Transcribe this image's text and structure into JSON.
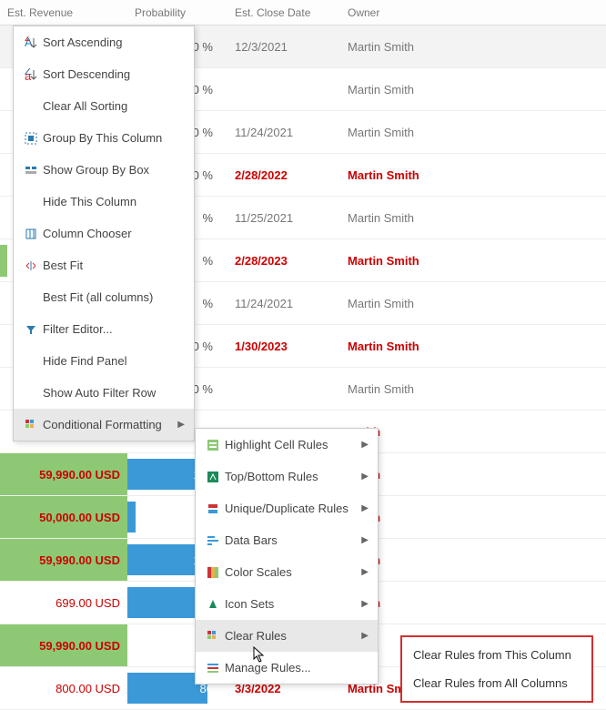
{
  "headers": {
    "revenue": "Est. Revenue",
    "probability": "Probability",
    "closeDate": "Est. Close Date",
    "owner": "Owner"
  },
  "rows": [
    {
      "rev": "",
      "prob": "0 %",
      "probPct": 0,
      "date": "12/3/2021",
      "owner": "Martin Smith",
      "bold": false,
      "sel": true
    },
    {
      "rev": "",
      "prob": "0 %",
      "probPct": 0,
      "date": "",
      "owner": "Martin Smith",
      "bold": false
    },
    {
      "rev": "",
      "prob": "0 %",
      "probPct": 0,
      "date": "11/24/2021",
      "owner": "Martin Smith",
      "bold": false,
      "barLeft": true
    },
    {
      "rev": "",
      "prob": "0 %",
      "probPct": 0,
      "date": "2/28/2022",
      "owner": "Martin Smith",
      "bold": true
    },
    {
      "rev": "",
      "prob": "%",
      "probPct": 5,
      "date": "11/25/2021",
      "owner": "Martin Smith",
      "bold": false
    },
    {
      "rev": "",
      "prob": "%",
      "probPct": 5,
      "date": "2/28/2023",
      "owner": "Martin Smith",
      "bold": true,
      "handle": true
    },
    {
      "rev": "",
      "prob": "%",
      "probPct": 5,
      "date": "11/24/2021",
      "owner": "Martin Smith",
      "bold": false
    },
    {
      "rev": "",
      "prob": "0 %",
      "probPct": 0,
      "date": "1/30/2023",
      "owner": "Martin Smith",
      "bold": true
    },
    {
      "rev": "",
      "prob": "0 %",
      "probPct": 0,
      "date": "",
      "owner": "Martin Smith",
      "bold": false
    },
    {
      "rev": "",
      "prob": "",
      "probPct": 0,
      "date": "",
      "owner": "Smith",
      "bold": true,
      "ownerOnly": true
    },
    {
      "rev": "59,990.00 USD",
      "prob": "100",
      "probPct": 100,
      "date": "",
      "owner": "Smith",
      "bold": true,
      "green": true
    },
    {
      "rev": "50,000.00 USD",
      "prob": "",
      "probPct": 8,
      "date": "",
      "owner": "Smith",
      "bold": true,
      "green": true
    },
    {
      "rev": "59,990.00 USD",
      "prob": "100",
      "probPct": 100,
      "date": "",
      "owner": "Smith",
      "bold": true,
      "green": true
    },
    {
      "rev": "699.00 USD",
      "prob": "80",
      "probPct": 80,
      "date": "",
      "owner": "Smith",
      "bold": true
    },
    {
      "rev": "59,990.00 USD",
      "prob": "",
      "probPct": 0,
      "date": "",
      "owner": "",
      "bold": true,
      "green": true
    },
    {
      "rev": "800.00 USD",
      "prob": "80",
      "probPct": 80,
      "date": "3/3/2022",
      "owner": "Martin Smith",
      "bold": true
    }
  ],
  "menu1": {
    "sortAsc": "Sort Ascending",
    "sortDesc": "Sort Descending",
    "clearSort": "Clear All Sorting",
    "groupBy": "Group By This Column",
    "showGroupBox": "Show Group By Box",
    "hideCol": "Hide This Column",
    "colChooser": "Column Chooser",
    "bestFit": "Best Fit",
    "bestFitAll": "Best Fit (all columns)",
    "filterEditor": "Filter Editor...",
    "hideFind": "Hide Find Panel",
    "showAutoFilter": "Show Auto Filter Row",
    "conditional": "Conditional Formatting"
  },
  "menu2": {
    "highlight": "Highlight Cell Rules",
    "topBottom": "Top/Bottom Rules",
    "uniqueDup": "Unique/Duplicate Rules",
    "dataBars": "Data Bars",
    "colorScales": "Color Scales",
    "iconSets": "Icon Sets",
    "clearRules": "Clear Rules",
    "manageRules": "Manage Rules..."
  },
  "menu3": {
    "clearThis": "Clear Rules from This Column",
    "clearAll": "Clear Rules from All Columns"
  }
}
